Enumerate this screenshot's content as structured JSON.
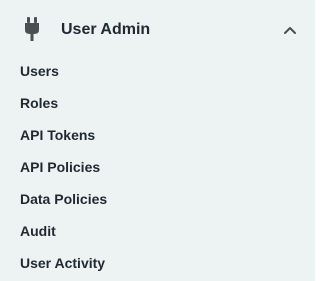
{
  "section": {
    "icon": "plug-icon",
    "title": "User Admin",
    "toggle_icon": "chevron-up-icon",
    "expanded": true
  },
  "nav": {
    "items": [
      {
        "label": "Users"
      },
      {
        "label": "Roles"
      },
      {
        "label": "API Tokens"
      },
      {
        "label": "API Policies"
      },
      {
        "label": "Data Policies"
      },
      {
        "label": "Audit"
      },
      {
        "label": "User Activity"
      }
    ]
  },
  "colors": {
    "panel_background": "#edf2f2",
    "text": "#1f2a30",
    "icon": "#4a4f52"
  }
}
